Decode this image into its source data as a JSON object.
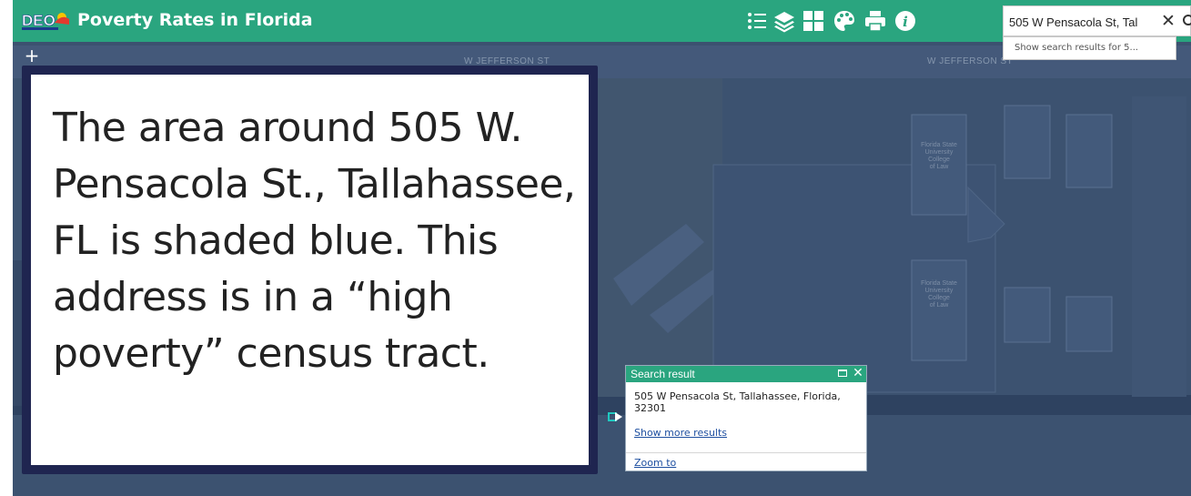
{
  "app": {
    "title": "Poverty Rates in Florida",
    "logo_text": "DEO",
    "logo_icon": "deo-logo",
    "colors": {
      "header": "#2aa57f",
      "map": "#3c5270",
      "caption_border": "#1f2550",
      "link": "#1e4fa0",
      "marker": "#1fc8c0"
    }
  },
  "toolbar": {
    "items": [
      {
        "icon": "legend-list-icon"
      },
      {
        "icon": "layers-icon"
      },
      {
        "icon": "basemap-gallery-icon"
      },
      {
        "icon": "color-palette-icon"
      },
      {
        "icon": "print-icon"
      },
      {
        "icon": "info-icon"
      }
    ]
  },
  "search": {
    "value": "505 W Pensacola St, Tal",
    "clear_icon": "close-icon",
    "submit_icon": "search-icon",
    "suggestion": "Show search results for 5..."
  },
  "map": {
    "zoom_in": "+",
    "street_labels": [
      "W JEFFERSON ST",
      "W JEFFERSON ST"
    ],
    "poi_labels": [
      "Florida State\nUniversity\nCollege\nof Law",
      "Florida State\nUniversity\nCollege\nof Law"
    ]
  },
  "caption": {
    "text": "The area around 505 W. Pensacola St., Tallahassee, FL is shaded blue. This address is in a “high poverty” census tract."
  },
  "popup": {
    "title": "Search result",
    "address": "505 W Pensacola St, Tallahassee, Florida, 32301",
    "more_link": "Show more results",
    "zoom_link": "Zoom to"
  }
}
